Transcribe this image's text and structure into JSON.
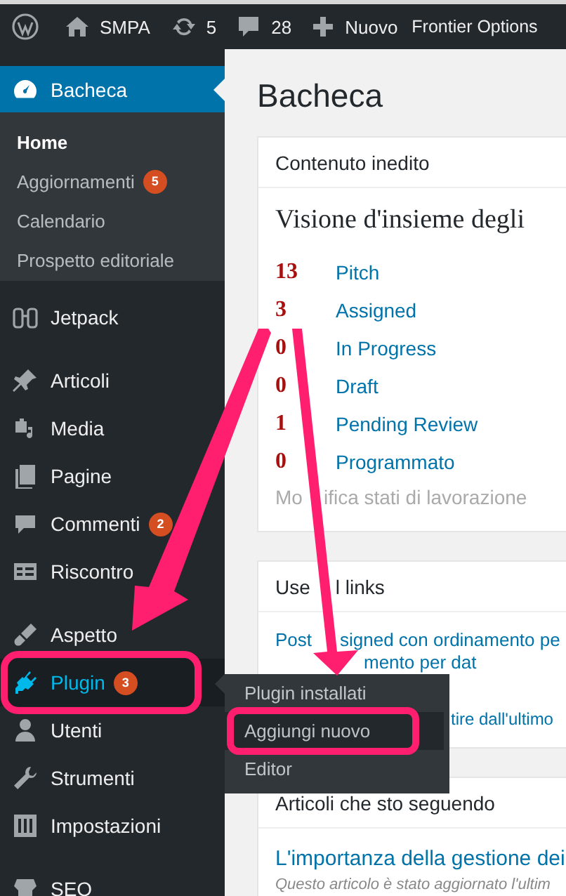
{
  "admin_bar": {
    "site": "SMPA",
    "updates": "5",
    "comments": "28",
    "new_label": "Nuovo",
    "extra": "Frontier Options"
  },
  "sidebar": {
    "groups": [
      [
        {
          "label": "Bacheca",
          "selected": true,
          "open": false,
          "submenu": [
            {
              "label": "Home",
              "selected": true
            },
            {
              "label": "Aggiornamenti",
              "selected": false,
              "badge": "5"
            },
            {
              "label": "Calendario",
              "selected": false
            },
            {
              "label": "Prospetto editoriale",
              "selected": false
            }
          ]
        }
      ],
      [
        {
          "label": "Jetpack",
          "selected": false,
          "open": false
        }
      ],
      [
        {
          "label": "Articoli",
          "selected": false,
          "open": false
        },
        {
          "label": "Media",
          "selected": false,
          "open": false
        },
        {
          "label": "Pagine",
          "selected": false,
          "open": false
        },
        {
          "label": "Commenti",
          "selected": false,
          "open": false,
          "badge": "2"
        },
        {
          "label": "Riscontro",
          "selected": false,
          "open": false
        }
      ],
      [
        {
          "label": "Aspetto",
          "selected": false,
          "open": false
        },
        {
          "label": "Plugin",
          "selected": false,
          "open": true,
          "badge": "3"
        },
        {
          "label": "Utenti",
          "selected": false,
          "open": false
        },
        {
          "label": "Strumenti",
          "selected": false,
          "open": false
        },
        {
          "label": "Impostazioni",
          "selected": false,
          "open": false
        }
      ],
      [
        {
          "label": "SEO",
          "selected": false,
          "open": false
        }
      ]
    ]
  },
  "flyout": [
    {
      "label": "Plugin installati",
      "selected": false
    },
    {
      "label": "Aggiungi nuovo",
      "selected": true
    },
    {
      "label": "Editor",
      "selected": false
    }
  ],
  "page_title": "Bacheca",
  "cards": [
    {
      "title_parts": [
        "Contenuto inedito"
      ],
      "heading": "Visione d'insieme degli",
      "statuses": [
        {
          "count": "13",
          "label": "Pitch"
        },
        {
          "count": "3",
          "label": "Assigned"
        },
        {
          "count": "0",
          "label": "In Progress"
        },
        {
          "count": "0",
          "label": "Draft"
        },
        {
          "count": "1",
          "label": "Pending Review"
        },
        {
          "count": "0",
          "label": "Programmato"
        }
      ],
      "footer_link_parts": [
        "Mo",
        "ifica stati di lavorazione"
      ]
    },
    {
      "title_parts": [
        "Use",
        "l links"
      ],
      "lines": [
        {
          "parts": [
            "Post",
            "signed con ordinamento pe"
          ]
        },
        {
          "parts": [
            "mento per dat"
          ]
        },
        {
          "parts": [
            "tire dall'ultimo"
          ]
        }
      ]
    },
    {
      "title_parts": [
        "Articoli che sto seguendo"
      ],
      "link": "L'importanza della gestione dei",
      "note": "Questo articolo è stato aggiornato l'ultim"
    }
  ]
}
